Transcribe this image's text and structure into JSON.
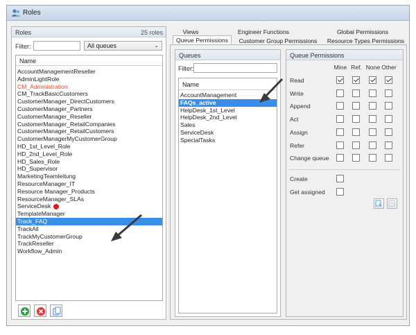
{
  "window": {
    "title": "Roles"
  },
  "roles": {
    "title": "Roles",
    "count": "25 roles",
    "filter_label": "Filter:",
    "filter_value": "",
    "dropdown_value": "All queues",
    "column_header": "Name",
    "items": [
      {
        "label": "AccountManagementReseller"
      },
      {
        "label": "AdminLightRole"
      },
      {
        "label": "CM_Administration",
        "style": "red"
      },
      {
        "label": "CM_TrackBasicCustomers"
      },
      {
        "label": "CustomerManager_DirectCustomers"
      },
      {
        "label": "CustomerManager_Partners"
      },
      {
        "label": "CustomerManager_Reseller"
      },
      {
        "label": "CustomerManager_RetailCompanies"
      },
      {
        "label": "CustomerManager_RetailCustomers"
      },
      {
        "label": "CustomerManagerMyCustomerGroup"
      },
      {
        "label": "HD_1st_Level_Role"
      },
      {
        "label": "HD_2nd_Level_Role"
      },
      {
        "label": "HD_Sales_Role"
      },
      {
        "label": "HD_Supervisor"
      },
      {
        "label": "MarketingTeamleitung"
      },
      {
        "label": "ResourceManager_IT"
      },
      {
        "label": "Resource Manager_Products"
      },
      {
        "label": "ResourceManager_SLAs"
      },
      {
        "label": "ServiceDesk",
        "dot": true
      },
      {
        "label": "TemplateManager"
      },
      {
        "label": "Track_FAQ",
        "selected": true
      },
      {
        "label": "TrackAll"
      },
      {
        "label": "TrackMyCustomerGroup"
      },
      {
        "label": "TrackReseller"
      },
      {
        "label": "Workflow_Admin"
      }
    ],
    "buttons": [
      {
        "name": "add-role-button",
        "icon": "plus-circle-icon",
        "color": "#2e9e3c"
      },
      {
        "name": "delete-role-button",
        "icon": "x-circle-icon",
        "color": "#e0323a"
      },
      {
        "name": "copy-role-button",
        "icon": "copy-icon",
        "color": "#4a90d9"
      }
    ]
  },
  "tabs": {
    "row1": [
      "Views",
      "Engineer Functions",
      "Global Permissions"
    ],
    "row2": [
      "Queue Permissions",
      "Customer Group Permissions",
      "Resource Types Permissions"
    ],
    "active": "Queue Permissions"
  },
  "queues": {
    "title": "Queues",
    "filter_label": "Filter:",
    "filter_value": "",
    "column_header": "Name",
    "items": [
      {
        "label": "AccountManagement"
      },
      {
        "label": "FAQs_active",
        "selected": true
      },
      {
        "label": "HelpDesk_1st_Level"
      },
      {
        "label": "HelpDesk_2nd_Level"
      },
      {
        "label": "Sales"
      },
      {
        "label": "ServiceDesk"
      },
      {
        "label": "SpecialTasks"
      }
    ]
  },
  "permissions": {
    "title": "Queue Permissions",
    "columns": [
      "Mine",
      "Ref.",
      "None",
      "Other"
    ],
    "rows": [
      {
        "label": "Read",
        "values": [
          true,
          true,
          true,
          true
        ]
      },
      {
        "label": "Write",
        "values": [
          false,
          false,
          false,
          false
        ]
      },
      {
        "label": "Append",
        "values": [
          false,
          false,
          false,
          false
        ]
      },
      {
        "label": "Act",
        "values": [
          false,
          false,
          false,
          false
        ]
      },
      {
        "label": "Assign",
        "values": [
          false,
          false,
          false,
          false
        ]
      },
      {
        "label": "Refer",
        "values": [
          false,
          false,
          false,
          false
        ]
      },
      {
        "label": "Change queue",
        "values": [
          false,
          false,
          false,
          false
        ]
      }
    ],
    "extra": [
      {
        "label": "Create",
        "value": false
      },
      {
        "label": "Get assigned",
        "value": false
      }
    ]
  },
  "colors": {
    "selection": "#3b8ee8",
    "red_text": "#e8452c",
    "status_dot": "#e21b1b",
    "arrow": "#3a3a3a"
  }
}
